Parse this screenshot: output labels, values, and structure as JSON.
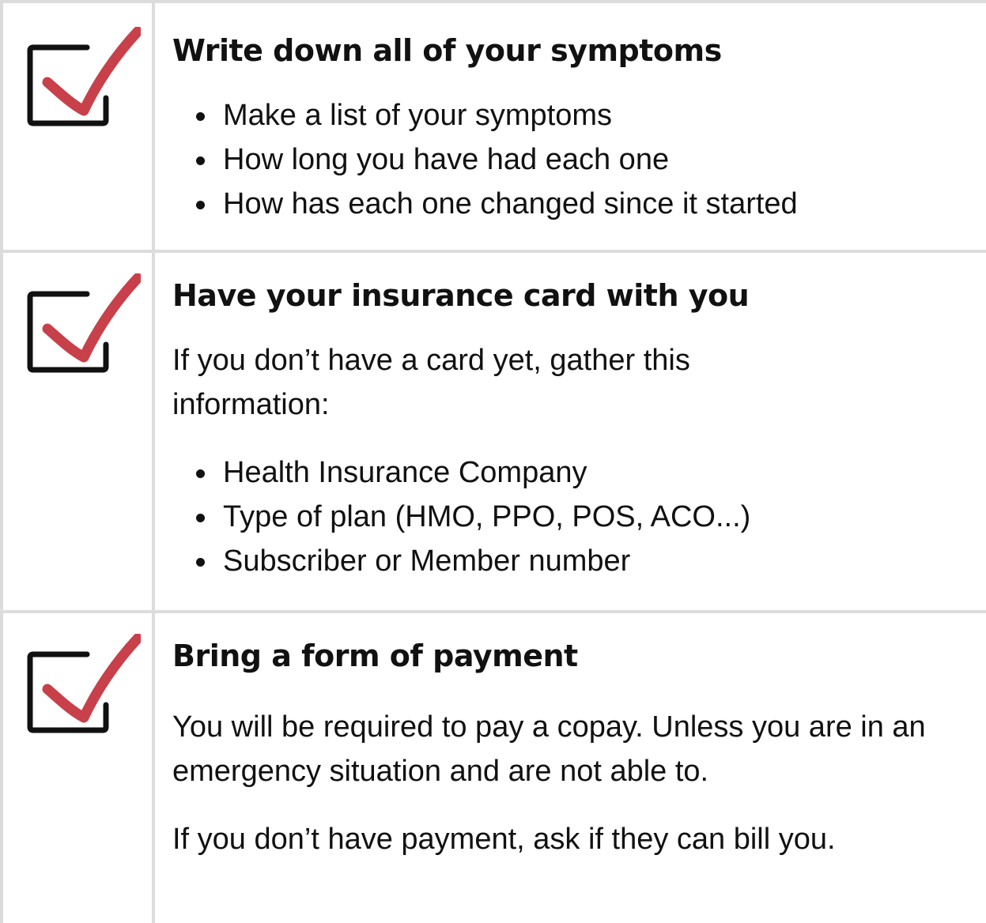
{
  "colors": {
    "check_mark": "#c8404a",
    "box_outline": "#111111",
    "grid_line": "#dcdcdc",
    "text": "#111111"
  },
  "items": [
    {
      "icon": "checkbox-checked-icon",
      "title": "Write down all of your symptoms",
      "bullets": [
        "Make a list of your symptoms",
        "How long you have had each one",
        "How has each one changed since it started"
      ]
    },
    {
      "icon": "checkbox-checked-icon",
      "title": "Have your insurance card with you",
      "paragraph": "If you don’t have a card yet, gather this information:",
      "bullets": [
        "Health Insurance Company",
        "Type of plan (HMO, PPO, POS, ACO...)",
        "Subscriber or Member number"
      ]
    },
    {
      "icon": "checkbox-checked-icon",
      "title": "Bring a form of payment",
      "paragraphs": [
        "You will be required to pay a copay. Unless you are in an emergency situation and are not able to.",
        "If you don’t have payment, ask if they can bill you."
      ]
    }
  ]
}
